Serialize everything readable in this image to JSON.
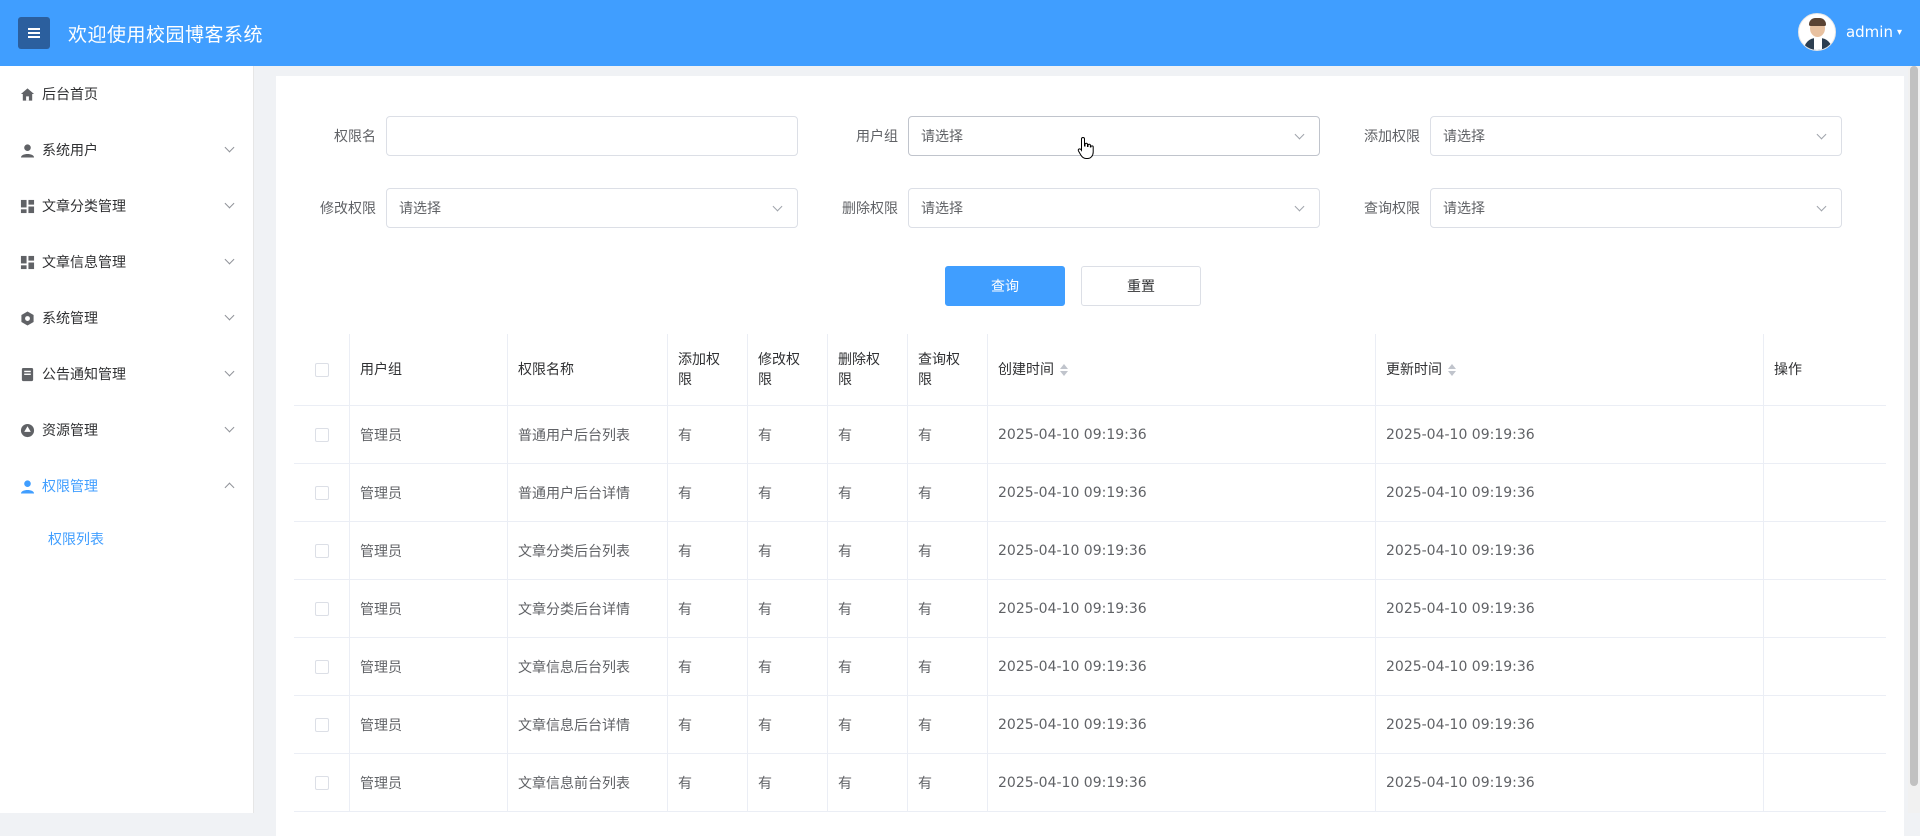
{
  "header": {
    "title": "欢迎使用校园博客系统",
    "username": "admin",
    "caret": "▾",
    "accent": "#409eff"
  },
  "sidebar": {
    "items": [
      {
        "label": "后台首页",
        "icon": "home-icon"
      },
      {
        "label": "系统用户",
        "icon": "user-icon"
      },
      {
        "label": "文章分类管理",
        "icon": "grid-icon"
      },
      {
        "label": "文章信息管理",
        "icon": "grid-icon"
      },
      {
        "label": "系统管理",
        "icon": "gear-icon"
      },
      {
        "label": "公告通知管理",
        "icon": "notice-icon"
      },
      {
        "label": "资源管理",
        "icon": "resource-icon"
      },
      {
        "label": "权限管理",
        "icon": "user-icon"
      }
    ],
    "sub_items": [
      {
        "label": "权限列表"
      }
    ]
  },
  "filters": {
    "perm_name": {
      "label": "权限名",
      "value": ""
    },
    "user_group": {
      "label": "用户组",
      "placeholder": "请选择"
    },
    "add_perm": {
      "label": "添加权限",
      "placeholder": "请选择"
    },
    "mod_perm": {
      "label": "修改权限",
      "placeholder": "请选择"
    },
    "del_perm": {
      "label": "删除权限",
      "placeholder": "请选择"
    },
    "query_perm": {
      "label": "查询权限",
      "placeholder": "请选择"
    }
  },
  "buttons": {
    "query": "查询",
    "reset": "重置"
  },
  "table": {
    "columns": {
      "group": "用户组",
      "name": "权限名称",
      "add": "添加权\n限",
      "mod": "修改权\n限",
      "del": "删除权\n限",
      "query": "查询权\n限",
      "ctime": "创建时间",
      "utime": "更新时间",
      "op": "操作"
    },
    "rows": [
      {
        "group": "管理员",
        "name": "普通用户后台列表",
        "add": "有",
        "mod": "有",
        "del": "有",
        "query": "有",
        "ctime": "2025-04-10 09:19:36",
        "utime": "2025-04-10 09:19:36"
      },
      {
        "group": "管理员",
        "name": "普通用户后台详情",
        "add": "有",
        "mod": "有",
        "del": "有",
        "query": "有",
        "ctime": "2025-04-10 09:19:36",
        "utime": "2025-04-10 09:19:36"
      },
      {
        "group": "管理员",
        "name": "文章分类后台列表",
        "add": "有",
        "mod": "有",
        "del": "有",
        "query": "有",
        "ctime": "2025-04-10 09:19:36",
        "utime": "2025-04-10 09:19:36"
      },
      {
        "group": "管理员",
        "name": "文章分类后台详情",
        "add": "有",
        "mod": "有",
        "del": "有",
        "query": "有",
        "ctime": "2025-04-10 09:19:36",
        "utime": "2025-04-10 09:19:36"
      },
      {
        "group": "管理员",
        "name": "文章信息后台列表",
        "add": "有",
        "mod": "有",
        "del": "有",
        "query": "有",
        "ctime": "2025-04-10 09:19:36",
        "utime": "2025-04-10 09:19:36"
      },
      {
        "group": "管理员",
        "name": "文章信息后台详情",
        "add": "有",
        "mod": "有",
        "del": "有",
        "query": "有",
        "ctime": "2025-04-10 09:19:36",
        "utime": "2025-04-10 09:19:36"
      },
      {
        "group": "管理员",
        "name": "文章信息前台列表",
        "add": "有",
        "mod": "有",
        "del": "有",
        "query": "有",
        "ctime": "2025-04-10 09:19:36",
        "utime": "2025-04-10 09:19:36"
      }
    ]
  }
}
